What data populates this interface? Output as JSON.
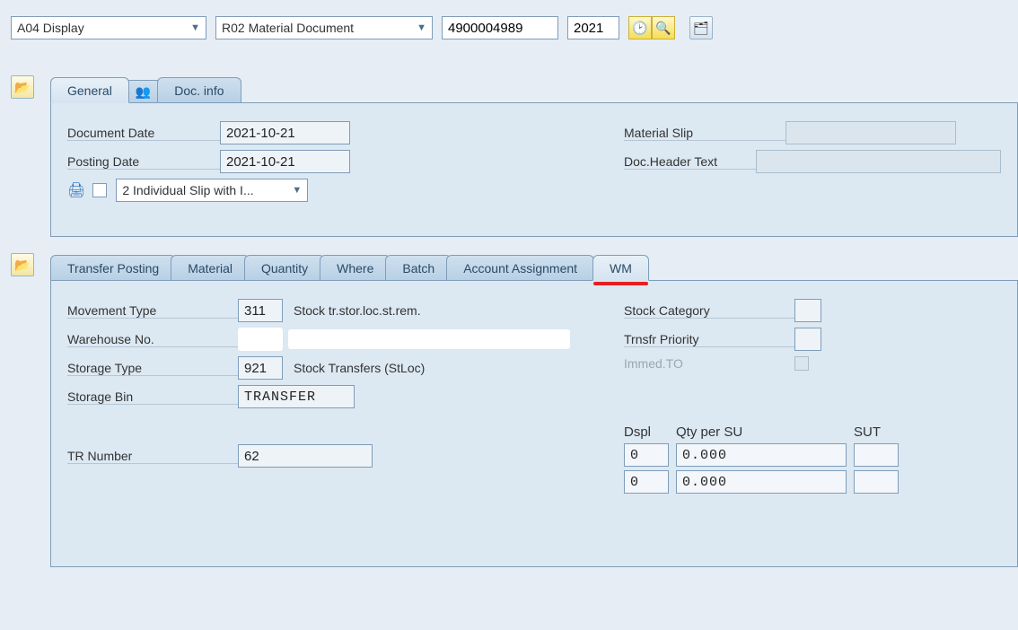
{
  "toolbar": {
    "action_dropdown": "A04 Display",
    "doc_type_dropdown": "R02 Material Document",
    "doc_number": "4900004989",
    "year": "2021"
  },
  "header_tabs": {
    "general": "General",
    "doc_info": "Doc. info"
  },
  "header_panel": {
    "document_date_label": "Document Date",
    "document_date": "2021-10-21",
    "posting_date_label": "Posting Date",
    "posting_date": "2021-10-21",
    "material_slip_label": "Material Slip",
    "material_slip": "",
    "doc_header_text_label": "Doc.Header Text",
    "doc_header_text": "",
    "slip_dropdown": "2 Individual Slip with I..."
  },
  "item_tabs": {
    "transfer_posting": "Transfer Posting",
    "material": "Material",
    "quantity": "Quantity",
    "where": "Where",
    "batch": "Batch",
    "account_assignment": "Account Assignment",
    "wm": "WM"
  },
  "wm_panel": {
    "movement_type_label": "Movement Type",
    "movement_type": "311",
    "movement_type_desc": "Stock tr.stor.loc.st.rem.",
    "warehouse_no_label": "Warehouse No.",
    "warehouse_no": "",
    "storage_type_label": "Storage Type",
    "storage_type": "921",
    "storage_type_desc": "Stock Transfers (StLoc)",
    "storage_bin_label": "Storage Bin",
    "storage_bin": "TRANSFER",
    "tr_number_label": "TR Number",
    "tr_number": "62",
    "stock_category_label": "Stock Category",
    "stock_category": "",
    "transfer_priority_label": "Trnsfr Priority",
    "transfer_priority": "",
    "immed_to_label": "Immed.TO",
    "su": {
      "dspl_label": "Dspl",
      "qty_label": "Qty per SU",
      "sut_label": "SUT",
      "rows": [
        {
          "dspl": "0",
          "qty": "0.000",
          "sut": ""
        },
        {
          "dspl": "0",
          "qty": "0.000",
          "sut": ""
        }
      ]
    }
  }
}
